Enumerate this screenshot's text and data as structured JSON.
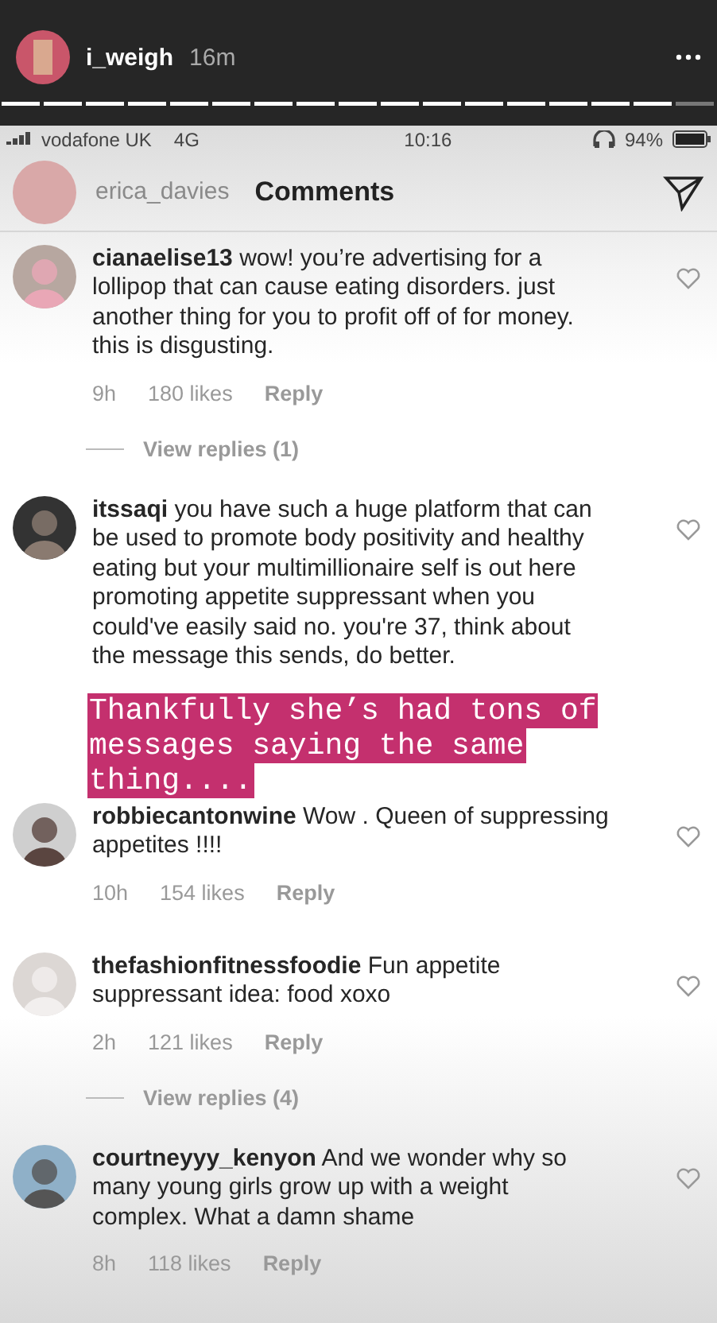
{
  "story": {
    "username": "i_weigh",
    "time": "16m"
  },
  "status_bar": {
    "carrier": "vodafone UK",
    "network": "4G",
    "time": "10:16",
    "battery": "94%"
  },
  "header": {
    "username": "erica_davies",
    "title": "Comments"
  },
  "comments": [
    {
      "username": "cianaelise13",
      "text": "wow! you’re advertising for a lollipop that can cause eating disorders. just another thing for you to profit off of for money. this is disgusting.",
      "time": "9h",
      "likes": "180 likes",
      "reply": "Reply",
      "liked": false,
      "view_replies": "View replies (1)"
    },
    {
      "username": "itssaqi",
      "text": "you have such a huge platform that can be used to promote body positivity and healthy eating but your multimillionaire self is out here promoting appetite suppressant when you could've easily said no. you're 37, think about the message this sends, do better.",
      "liked": false
    },
    {
      "username": "robbiecantonwine",
      "text": "Wow . Queen of suppressing appetites !!!!",
      "time": "10h",
      "likes": "154 likes",
      "reply": "Reply",
      "liked": false
    },
    {
      "username": "thefashionfitnessfoodie",
      "text": "Fun appetite suppressant idea: food xoxo",
      "time": "2h",
      "likes": "121 likes",
      "reply": "Reply",
      "liked": false,
      "view_replies": "View replies (4)"
    },
    {
      "username": "courtneyyy_kenyon",
      "text": "And we wonder why so many young girls grow up with a weight complex. What a damn shame",
      "time": "8h",
      "likes": "118 likes",
      "reply": "Reply",
      "liked": false
    }
  ],
  "caption": {
    "lines": [
      "Thankfully she’s had tons of",
      "messages saying the same",
      "thing...."
    ]
  }
}
